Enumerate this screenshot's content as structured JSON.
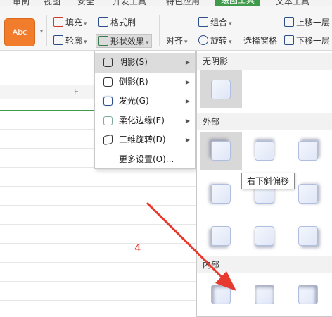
{
  "menubar": {
    "tabs": [
      "审阅",
      "视图",
      "安全",
      "开发工具",
      "特色应用",
      "绘图工具",
      "文本工具"
    ],
    "active_index": 5,
    "active_color": "#3f9a4a"
  },
  "ribbon": {
    "style_preview": "Abc",
    "fill": "填充",
    "format_painter": "格式刷",
    "outline": "轮廓",
    "shape_effects": "形状效果",
    "align": "对齐",
    "group": "组合",
    "rotate": "旋转",
    "selection_pane": "选择窗格",
    "bring_forward": "上移一层",
    "send_backward": "下移一层"
  },
  "sheet": {
    "column_label": "E"
  },
  "effects_menu": {
    "items": [
      {
        "label": "阴影(S)",
        "submenu": true
      },
      {
        "label": "倒影(R)",
        "submenu": true
      },
      {
        "label": "发光(G)",
        "submenu": true
      },
      {
        "label": "柔化边缘(E)",
        "submenu": true
      },
      {
        "label": "三维旋转(D)",
        "submenu": true
      },
      {
        "label": "更多设置(O)...",
        "submenu": false
      }
    ],
    "highlighted_index": 0
  },
  "shadow_panel": {
    "no_shadow": "无阴影",
    "outer": "外部",
    "inner": "内部",
    "tooltip": "右下斜偏移"
  },
  "annotation": {
    "step": "4",
    "color": "#e8392f"
  },
  "icons": [
    "fill-icon",
    "format-painter-icon",
    "outline-icon",
    "shape-effects-icon",
    "align-icon",
    "group-icon",
    "rotate-icon",
    "selection-pane-icon",
    "bring-forward-icon",
    "send-backward-icon",
    "submenu-arrow-icon"
  ]
}
